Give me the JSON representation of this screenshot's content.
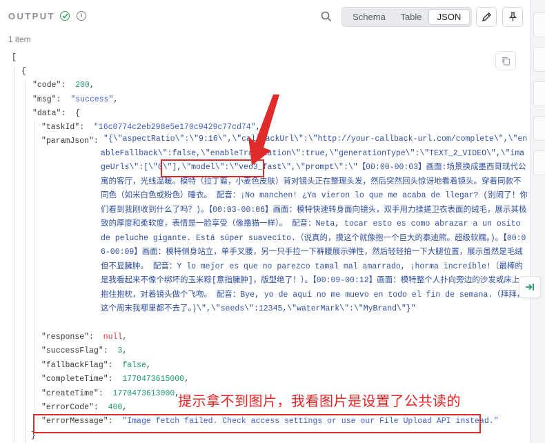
{
  "header": {
    "title": "OUTPUT",
    "info_icon_glyph": "i",
    "view_tabs": [
      {
        "label": "Schema",
        "selected": false
      },
      {
        "label": "Table",
        "selected": false
      },
      {
        "label": "JSON",
        "selected": true
      }
    ]
  },
  "item_count": "1 item",
  "json": {
    "open_array": "[",
    "open_obj": "{",
    "code_key": "\"code\"",
    "code_val": "200",
    "msg_key": "\"msg\"",
    "msg_val": "\"success\"",
    "data_key": "\"data\"",
    "data_open": "{",
    "taskId_key": "\"taskId\"",
    "taskId_val": "\"16c0774c2eb298e5e170c9429c77cd74\"",
    "paramJson_key": "\"paramJson\"",
    "paramJson_val": "\"{\\\"aspectRatio\\\":\\\"9:16\\\",\\\"callBackUrl\\\":\\\"http://your-callback-url.com/complete\\\",\\\"enableFallback\\\":false,\\\"enableTranslation\\\":true,\\\"generationType\\\":\\\"TEXT_2_VIDEO\\\",\\\"imageUrls\\\":[\\\"0\\\"],\\\"model\\\":\\\"veo3_fast\\\",\\\"prompt\\\":\\\"【00:00-00:03】画面:场景换成墨西哥现代公寓的客厅，光线温暖。模特（拉丁裔，小麦色皮肤）背对镜头正在整理头发，然后突然回头惊讶地看着镜头。穿着同款不同色（如米白色或粉色）睡衣。 配音：¡No manchen! ¿Ya vieron lo que me acaba de llegar? (别闹了！你们看到我刚收到什么了吗？)。【00:03-00:06】画面：模特快速转身面向镜头，双手用力揉搓卫衣表面的绒毛，展示其极致的厚度和柔软度，表情是一脸享受（像撸猫一样）。 配音：Neta, tocar esto es como abrazar a un osito de peluche gigante. Está súper suavecito.（说真的，摸这个就像抱一个巨大的泰迪熊。超级软糯。)。【00:06-00:09】画面：模特侧身站立，单手叉腰，另一只手拉一下裤腰展示弹性，然后轻轻拍一下大腿位置，展示虽然是毛绒但不显臃肿。 配音：Y lo mejor es que no parezco tamal mal amarrado, ¡horma increíble!（最棒的是我看起来不像个绑坏的玉米粽[意指臃肿]，版型绝了！）。【00:09-00:12】画面：模特整个人扑向旁边的沙发或床上，抱住抱枕，对着镜头做个飞吻。 配音：Bye, yo de aquí no me muevo en todo el fin de semana.（拜拜，这个周末我哪里都不去了。)\\\",\\\"seeds\\\":12345,\\\"waterMark\\\":\\\"MyBrand\\\"}\"",
    "response_key": "\"response\"",
    "response_val": "null",
    "successFlag_key": "\"successFlag\"",
    "successFlag_val": "3",
    "fallbackFlag_key": "\"fallbackFlag\"",
    "fallbackFlag_val": "false",
    "completeTime_key": "\"completeTime\"",
    "completeTime_val": "1770473615000",
    "createTime_key": "\"createTime\"",
    "createTime_val": "1770473613000",
    "errorCode_key": "\"errorCode\"",
    "errorCode_val": "400",
    "errorMessage_key": "\"errorMessage\"",
    "errorMessage_val": "\"Image fetch failed. Check access settings or use our File Upload API instead.\"",
    "close_obj": "}"
  },
  "annotation": "提示拿不到图片，我看图片是设置了公共读的",
  "colors": {
    "annotation_red": "#e02b2b",
    "number_green": "#1e9a6b",
    "string_blue": "#3f5fc6",
    "null_red": "#d7433b",
    "success_check": "#2f9e5a"
  }
}
